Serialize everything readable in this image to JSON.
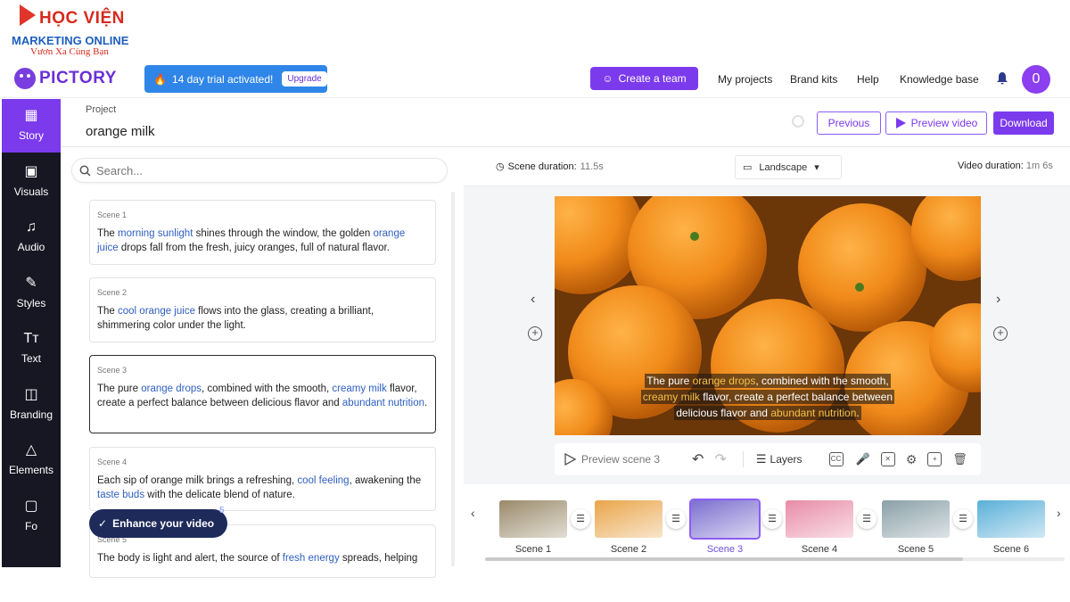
{
  "watermark": {
    "line1": "HỌC VIỆN",
    "line2": "MARKETING ONLINE",
    "line3": "Vươn Xa Cùng Bạn"
  },
  "app": {
    "name": "PICTORY"
  },
  "trial": {
    "text": "14 day trial activated!",
    "upgrade": "Upgrade"
  },
  "header": {
    "create_team": "Create a team",
    "links": [
      "My projects",
      "Brand kits",
      "Help",
      "Knowledge base"
    ],
    "avatar_initial": "0"
  },
  "sidebar": {
    "items": [
      {
        "label": "Story",
        "icon": "story-icon",
        "active": true
      },
      {
        "label": "Visuals",
        "icon": "image-icon"
      },
      {
        "label": "Audio",
        "icon": "music-icon"
      },
      {
        "label": "Styles",
        "icon": "styles-icon"
      },
      {
        "label": "Text",
        "icon": "text-icon"
      },
      {
        "label": "Branding",
        "icon": "briefcase-icon"
      },
      {
        "label": "Elements",
        "icon": "shapes-icon"
      },
      {
        "label": "Fo",
        "icon": "format-icon"
      }
    ]
  },
  "project": {
    "label": "Project",
    "name": "orange milk"
  },
  "actions": {
    "previous": "Previous",
    "preview": "Preview video",
    "download": "Download"
  },
  "search": {
    "placeholder": "Search..."
  },
  "scenes": [
    {
      "label": "Scene 1",
      "parts": [
        [
          "The ",
          0
        ],
        [
          "morning sunlight",
          1
        ],
        [
          " shines through the window, the golden ",
          0
        ],
        [
          "orange juice",
          1
        ],
        [
          " drops fall from the fresh, juicy oranges, full of natural flavor.",
          0
        ]
      ]
    },
    {
      "label": "Scene 2",
      "parts": [
        [
          "The ",
          0
        ],
        [
          "cool orange juice",
          1
        ],
        [
          " flows into the glass, creating a brilliant, shimmering color under the light.",
          0
        ]
      ]
    },
    {
      "label": "Scene 3",
      "parts": [
        [
          "The pure ",
          0
        ],
        [
          "orange drops",
          1
        ],
        [
          ", combined with the smooth, ",
          0
        ],
        [
          "creamy milk",
          1
        ],
        [
          " flavor, create a perfect balance between delicious flavor and ",
          0
        ],
        [
          "abundant nutrition",
          1
        ],
        [
          ".",
          0
        ]
      ]
    },
    {
      "label": "Scene 4",
      "parts": [
        [
          "Each sip of orange milk brings a refreshing, ",
          0
        ],
        [
          "cool feeling",
          1
        ],
        [
          ", awakening the ",
          0
        ],
        [
          "taste buds",
          1
        ],
        [
          " with the delicate blend of nature.",
          0
        ]
      ]
    },
    {
      "label": "Scene 5",
      "parts": [
        [
          "The body is light and alert, the source of ",
          0
        ],
        [
          "fresh energy",
          1
        ],
        [
          " spreads, helping",
          0
        ]
      ]
    }
  ],
  "enhance": {
    "label": "Enhance your video",
    "count": "5"
  },
  "editor": {
    "scene_duration_label": "Scene duration:",
    "scene_duration_value": "11.5s",
    "orientation": "Landscape",
    "video_duration_label": "Video duration:",
    "video_duration_value": "1m 6s",
    "caption_parts": [
      [
        "The pure ",
        0
      ],
      [
        "orange drops",
        1
      ],
      [
        ", combined with the smooth,",
        0
      ],
      [
        "|",
        2
      ],
      [
        "creamy milk",
        1
      ],
      [
        " flavor, create a perfect balance between",
        0
      ],
      [
        "|",
        2
      ],
      [
        "delicious flavor and ",
        0
      ],
      [
        "abundant nutrition",
        1
      ],
      [
        ".",
        0
      ]
    ],
    "preview_scene": "Preview scene 3",
    "layers": "Layers"
  },
  "timeline": {
    "scenes": [
      {
        "label": "Scene 1",
        "color": "#9a8a6a"
      },
      {
        "label": "Scene 2",
        "color": "#e9a54a"
      },
      {
        "label": "Scene 3",
        "color": "#7c6fcf",
        "selected": true
      },
      {
        "label": "Scene 4",
        "color": "#e88ca8"
      },
      {
        "label": "Scene 5",
        "color": "#8aa0a8"
      },
      {
        "label": "Scene 6",
        "color": "#5ab0d8"
      }
    ]
  },
  "colors": {
    "accent": "#7c3aed",
    "sidebar_bg": "#171723",
    "highlight_text": "#2f5fc0",
    "caption_highlight": "#f5c24a"
  }
}
